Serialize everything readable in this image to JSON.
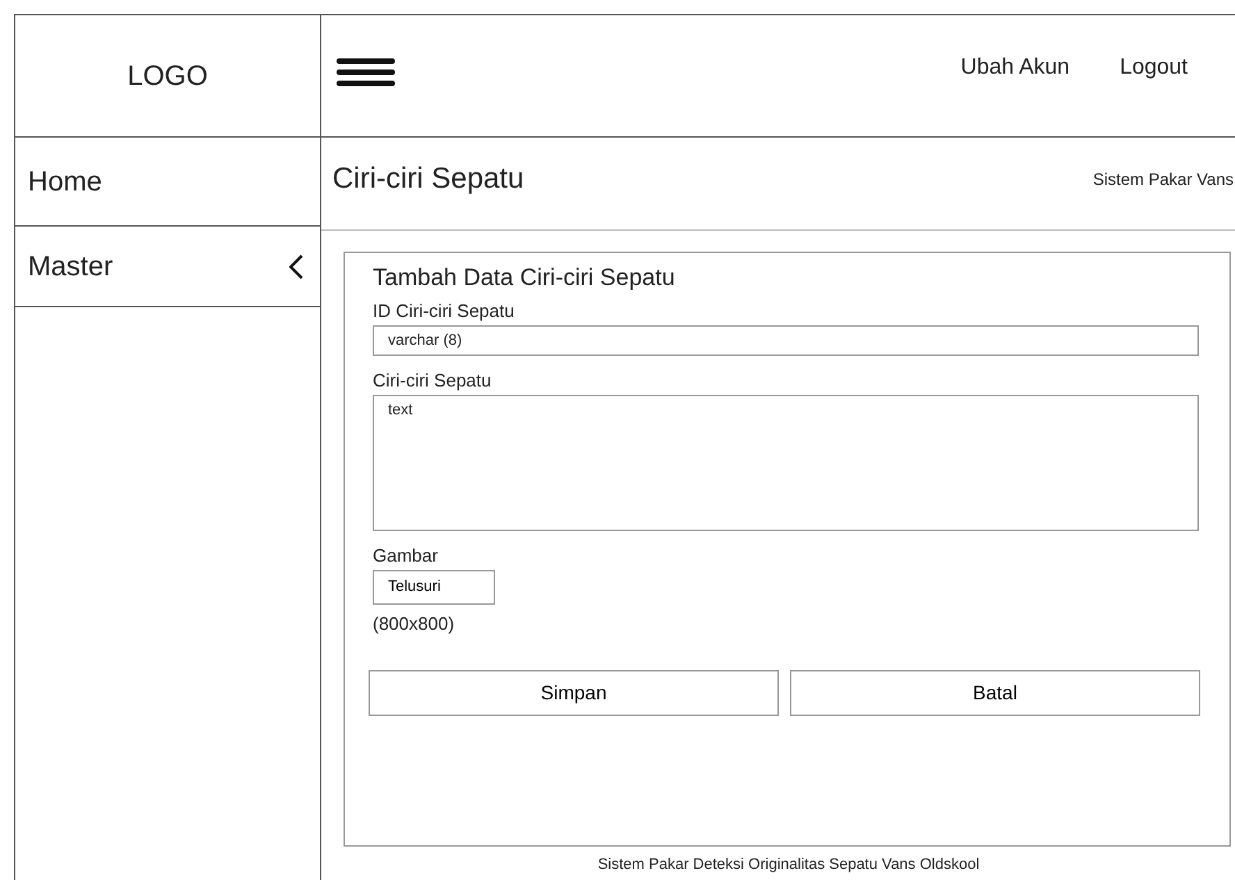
{
  "logo": "LOGO",
  "header": {
    "links": [
      "Ubah Akun",
      "Logout"
    ]
  },
  "sidebar": {
    "items": [
      {
        "label": "Home",
        "expandable": false
      },
      {
        "label": "Master",
        "expandable": true
      }
    ]
  },
  "page": {
    "title": "Ciri-ciri Sepatu",
    "breadcrumb": "Sistem Pakar Vans"
  },
  "form": {
    "title": "Tambah Data Ciri-ciri Sepatu",
    "fields": [
      {
        "kind": "text",
        "label": "ID Ciri-ciri Sepatu",
        "value": "varchar (8)"
      },
      {
        "kind": "textarea",
        "label": "Ciri-ciri Sepatu",
        "value": "text"
      },
      {
        "kind": "file",
        "label": "Gambar",
        "button": "Telusuri",
        "hint": "(800x800)"
      }
    ],
    "buttons": [
      "Simpan",
      "Batal"
    ]
  },
  "footer": "Sistem Pakar Deteksi Originalitas Sepatu Vans Oldskool"
}
